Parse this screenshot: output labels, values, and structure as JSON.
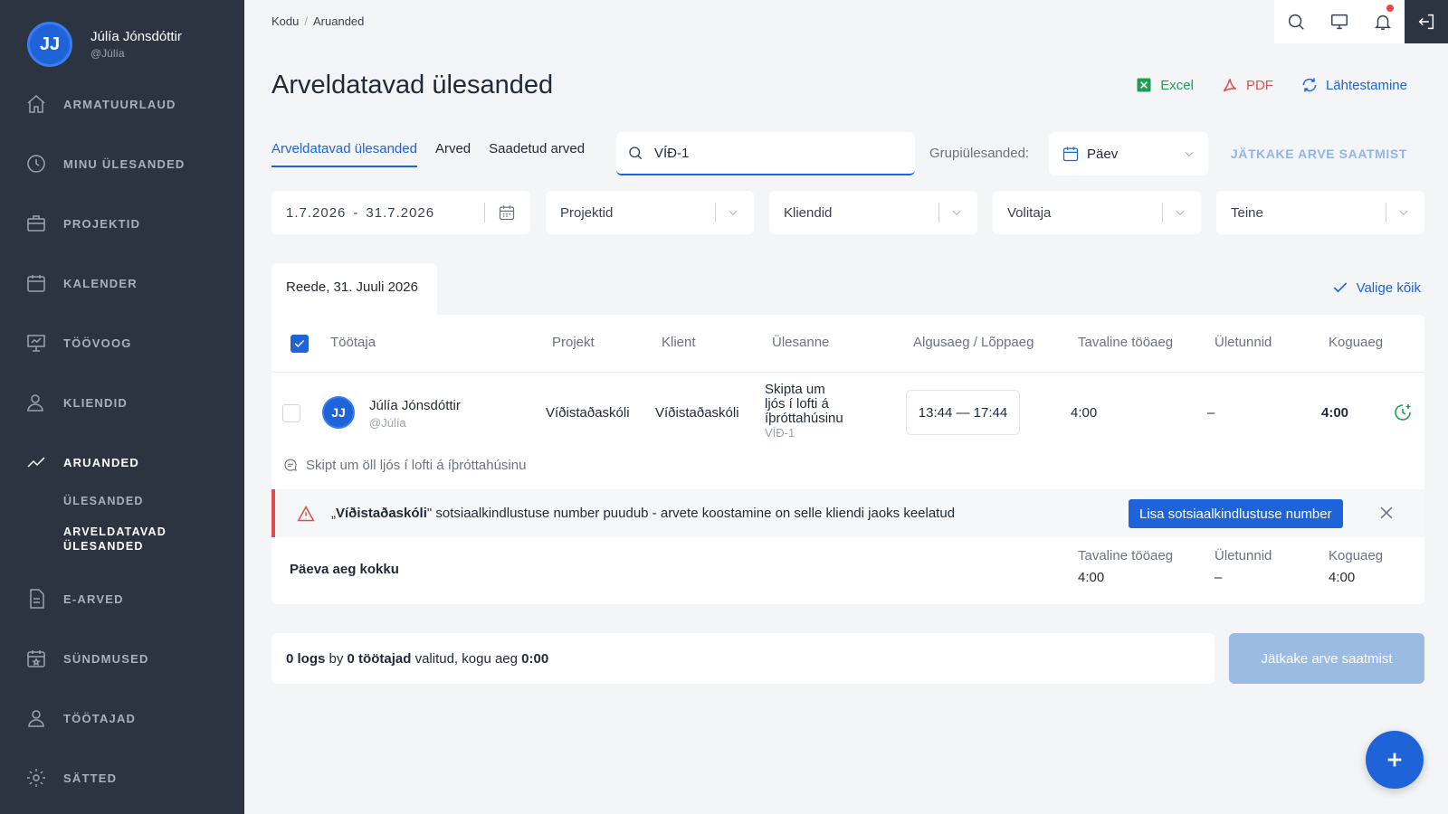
{
  "user": {
    "initials": "JJ",
    "name": "Júlía Jónsdóttir",
    "handle": "@Júlía"
  },
  "nav": {
    "dashboard": "ARMATUURLAUD",
    "my_tasks": "MINU ÜLESANDED",
    "projects": "PROJEKTID",
    "calendar": "KALENDER",
    "workflow": "TÖÖVOOG",
    "clients": "KLIENDID",
    "reports": "ARUANDED",
    "sub_tasks": "ÜLESANDED",
    "sub_billable_line1": "ARVELDATAVAD",
    "sub_billable_line2": "ÜLESANDED",
    "einvoices": "E-ARVED",
    "events": "SÜNDMUSED",
    "employees": "TÖÖTAJAD",
    "settings": "SÄTTED"
  },
  "breadcrumb": {
    "home": "Kodu",
    "current": "Aruanded"
  },
  "page_title": "Arveldatavad ülesanded",
  "actions": {
    "excel": "Excel",
    "pdf": "PDF",
    "reset": "Lähtestamine"
  },
  "tabs": {
    "billable": "Arveldatavad ülesanded",
    "invoices": "Arved",
    "sent": "Saadetud arved"
  },
  "search": {
    "value": "VÍÐ-1"
  },
  "group": {
    "label": "Grupiülesanded:",
    "value": "Päev"
  },
  "send_top": "JÄTKAKE ARVE SAATMIST",
  "filters": {
    "date_from": "1.7.2026",
    "date_sep": "-",
    "date_to": "31.7.2026",
    "projects": "Projektid",
    "clients": "Kliendid",
    "assignee": "Volitaja",
    "other": "Teine"
  },
  "day": {
    "label": "Reede, 31. Juuli 2026",
    "select_all": "Valige kõik"
  },
  "columns": {
    "employee": "Töötaja",
    "project": "Projekt",
    "client": "Klient",
    "task": "Ülesanne",
    "time_range": "Algusaeg / Lõppaeg",
    "regular": "Tavaline tööaeg",
    "overtime": "Ületunnid",
    "total": "Koguaeg"
  },
  "row": {
    "initials": "JJ",
    "name": "Júlía Jónsdóttir",
    "handle": "@Júlía",
    "project": "Víðistaðaskóli",
    "client": "Víðistaðaskóli",
    "task_line1": "Skipta um",
    "task_line2": "ljós í lofti á",
    "task_line3": "íþróttahúsinu",
    "task_code": "VÍÐ-1",
    "time_range": "13:44 — 17:44",
    "regular": "4:00",
    "overtime": "–",
    "total": "4:00",
    "comment": "Skipt um öll ljós í lofti á íþróttahúsinu"
  },
  "alert": {
    "quote_open": "„",
    "client": "Víðistaðaskóli",
    "message": "\" sotsiaalkindlustuse number puudub - arvete koostamine on selle kliendi jaoks keelatud",
    "button": "Lisa sotsiaalkindlustuse number"
  },
  "totals": {
    "label": "Päeva aeg kokku",
    "regular_label": "Tavaline tööaeg",
    "regular": "4:00",
    "overtime_label": "Ületunnid",
    "overtime": "–",
    "total_label": "Koguaeg",
    "total": "4:00"
  },
  "summary": {
    "logs": "0 logs",
    "by": "by",
    "employees": "0 töötajad",
    "selected": "valitud, kogu aeg",
    "time": "0:00"
  },
  "send_button": "Jätkake arve saatmist",
  "colors": {
    "sidebar": "#2b3440",
    "accent": "#1e63d8",
    "excel": "#1f9d55",
    "pdf": "#e24c4c",
    "alert": "#e24c4c"
  }
}
